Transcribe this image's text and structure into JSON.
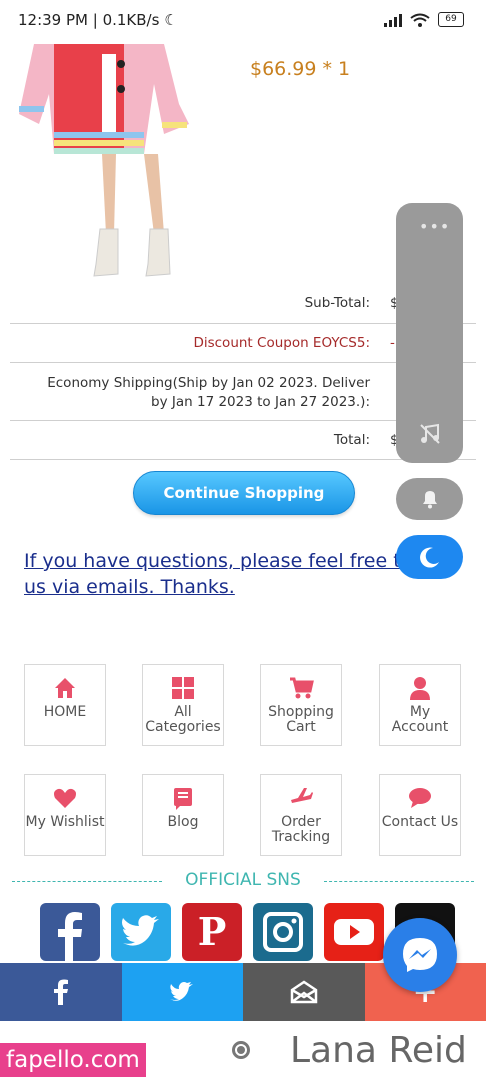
{
  "status_bar": {
    "time_speed": "12:39 PM | 0.1KB/s",
    "battery": "69"
  },
  "product": {
    "price": "$66.99 * 1"
  },
  "summary": {
    "subtotal_label": "Sub-Total:",
    "subtotal_value": "$",
    "discount_label": "Discount Coupon EOYCS5:",
    "discount_value": "-",
    "shipping_label": "Economy Shipping(Ship by Jan 02 2023. Deliver by Jan 17 2023 to Jan 27 2023.):",
    "total_label": "Total:",
    "total_value": "$"
  },
  "continue_button": "Continue Shopping",
  "questions_text": "If you have questions, please feel free to c... us via emails. Thanks.",
  "nav_tiles": [
    {
      "label": "HOME"
    },
    {
      "label": "All Categories"
    },
    {
      "label": "Shopping Cart"
    },
    {
      "label": "My Account"
    },
    {
      "label": "My Wishlist"
    },
    {
      "label": "Blog"
    },
    {
      "label": "Order Tracking"
    },
    {
      "label": "Contact Us"
    }
  ],
  "sns_title": "OFFICIAL SNS",
  "sns_icons": [
    "facebook-icon",
    "twitter-icon",
    "pinterest-icon",
    "instagram-icon",
    "youtube-icon",
    "tiktok-icon"
  ],
  "share_bar": [
    "facebook-icon",
    "twitter-icon",
    "mail-icon",
    "plus-icon"
  ],
  "colors": {
    "accent_red": "#e8506a",
    "link_blue": "#1a2e8c",
    "price_orange": "#c8801f",
    "sns_teal": "#3fb6b0",
    "button_blue": "#1a95e6"
  },
  "watermark": {
    "left": "fapello.com",
    "right": "Lana Reid"
  }
}
